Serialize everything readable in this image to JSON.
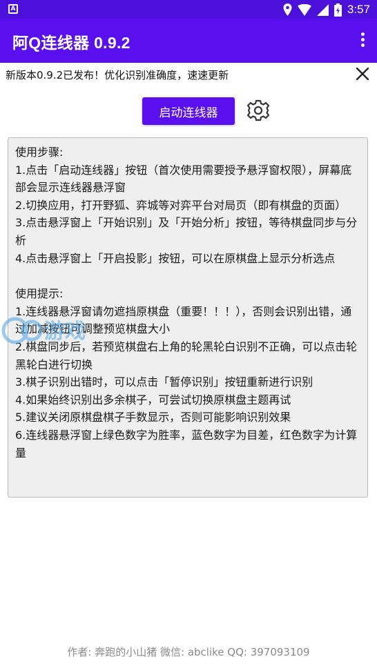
{
  "status_bar": {
    "time": "3:57"
  },
  "app_bar": {
    "title": "阿Q连线器 0.9.2"
  },
  "notice": {
    "text": "新版本0.9.2已发布！优化识别准确度，速速更新"
  },
  "actions": {
    "start_label": "启动连线器"
  },
  "instructions": {
    "steps_title": "使用步骤:",
    "steps": [
      "1.点击「启动连线器」按钮（首次使用需要授予悬浮窗权限），屏幕底部会显示连线器悬浮窗",
      "2.切换应用，打开野狐、弈城等对弈平台对局页（即有棋盘的页面）",
      "3.点击悬浮窗上「开始识别」及「开始分析」按钮，等待棋盘同步与分析",
      "4.点击悬浮窗上「开启投影」按钮，可以在原棋盘上显示分析选点"
    ],
    "tips_title": "使用提示:",
    "tips": [
      "1.连线器悬浮窗请勿遮挡原棋盘（重要！！！），否则会识别出错，通过加减按钮可调整预览棋盘大小",
      "2.棋盘同步后，若预览棋盘右上角的轮黑轮白识别不正确，可以点击轮黑轮白进行切换",
      "3.棋子识别出错时，可以点击「暂停识别」按钮重新进行识别",
      "4.如果始终识别出多余棋子，可尝试切换原棋盘主题再试",
      "5.建议关闭原棋盘棋子手数显示，否则可能影响识别效果",
      "6.连线器悬浮窗上绿色数字为胜率，蓝色数字为目差，红色数字为计算量"
    ]
  },
  "watermark": {
    "text": "游戏"
  },
  "footer": {
    "text": "作者: 奔跑的小山猪 微信: abclike QQ: 397093109"
  },
  "colors": {
    "status_bar": "#4b10d9",
    "app_bar": "#5a10ee",
    "button": "#5a10ee",
    "panel_bg": "#efefef"
  }
}
